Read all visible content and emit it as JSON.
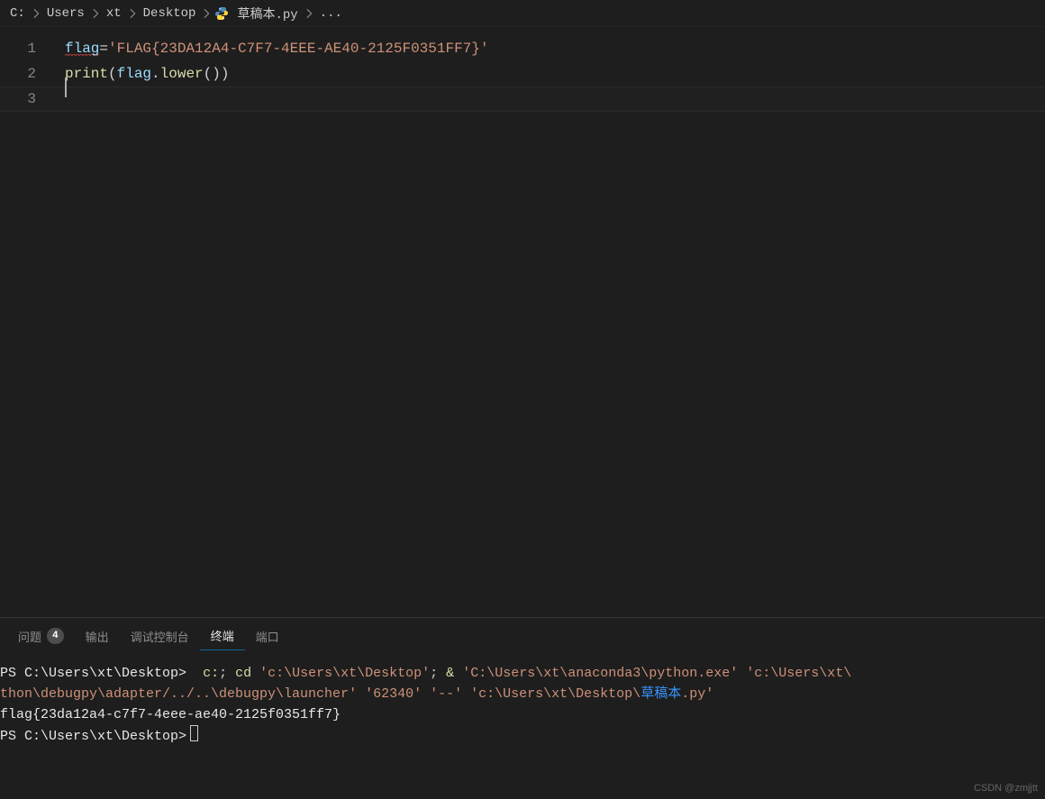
{
  "breadcrumb": {
    "parts": [
      "C:",
      "Users",
      "xt",
      "Desktop",
      "草稿本.py",
      "..."
    ],
    "file_icon": "python-icon"
  },
  "editor": {
    "lines": [
      {
        "num": "1"
      },
      {
        "num": "2"
      },
      {
        "num": "3"
      }
    ],
    "code": {
      "l1_var": "flag",
      "l1_eq": "=",
      "l1_str": "'FLAG{23DA12A4-C7F7-4EEE-AE40-2125F0351FF7}'",
      "l2_fn": "print",
      "l2_open": "(",
      "l2_var": "flag",
      "l2_dot": ".",
      "l2_method": "lower",
      "l2_call_open": "(",
      "l2_call_close": ")",
      "l2_close": ")"
    }
  },
  "panel": {
    "tabs": {
      "problems": "问题",
      "problems_count": "4",
      "output": "输出",
      "debug_console": "调试控制台",
      "terminal": "终端",
      "ports": "端口"
    }
  },
  "terminal": {
    "prompt1_ps": "PS ",
    "prompt1_path": "C:\\Users\\xt\\Desktop",
    "prompt1_gt": ">",
    "cmd_c": "c:",
    "cmd_sep1": "; ",
    "cmd_cd": "cd ",
    "cmd_path1": "'c:\\Users\\xt\\Desktop'",
    "cmd_sep2": "; ",
    "cmd_amp": "& ",
    "cmd_python": "'C:\\Users\\xt\\anaconda3\\python.exe'",
    "cmd_sp1": " ",
    "cmd_ext": "'c:\\Users\\xt\\",
    "cmd_line2a": "thon\\debugpy\\adapter/../..\\debugpy\\launcher'",
    "cmd_sp2": " ",
    "cmd_port": "'62340'",
    "cmd_sp3": " ",
    "cmd_dash": "'--'",
    "cmd_sp4": " ",
    "cmd_script_prefix": "'c:\\Users\\xt\\Desktop\\",
    "cmd_script_cn": "草稿本",
    "cmd_script_suffix": ".py'",
    "output_flag": "flag{23da12a4-c7f7-4eee-ae40-2125f0351ff7}",
    "prompt2_ps": "PS ",
    "prompt2_path": "C:\\Users\\xt\\Desktop",
    "prompt2_gt": ">"
  },
  "watermark": "CSDN @zmjjtt"
}
